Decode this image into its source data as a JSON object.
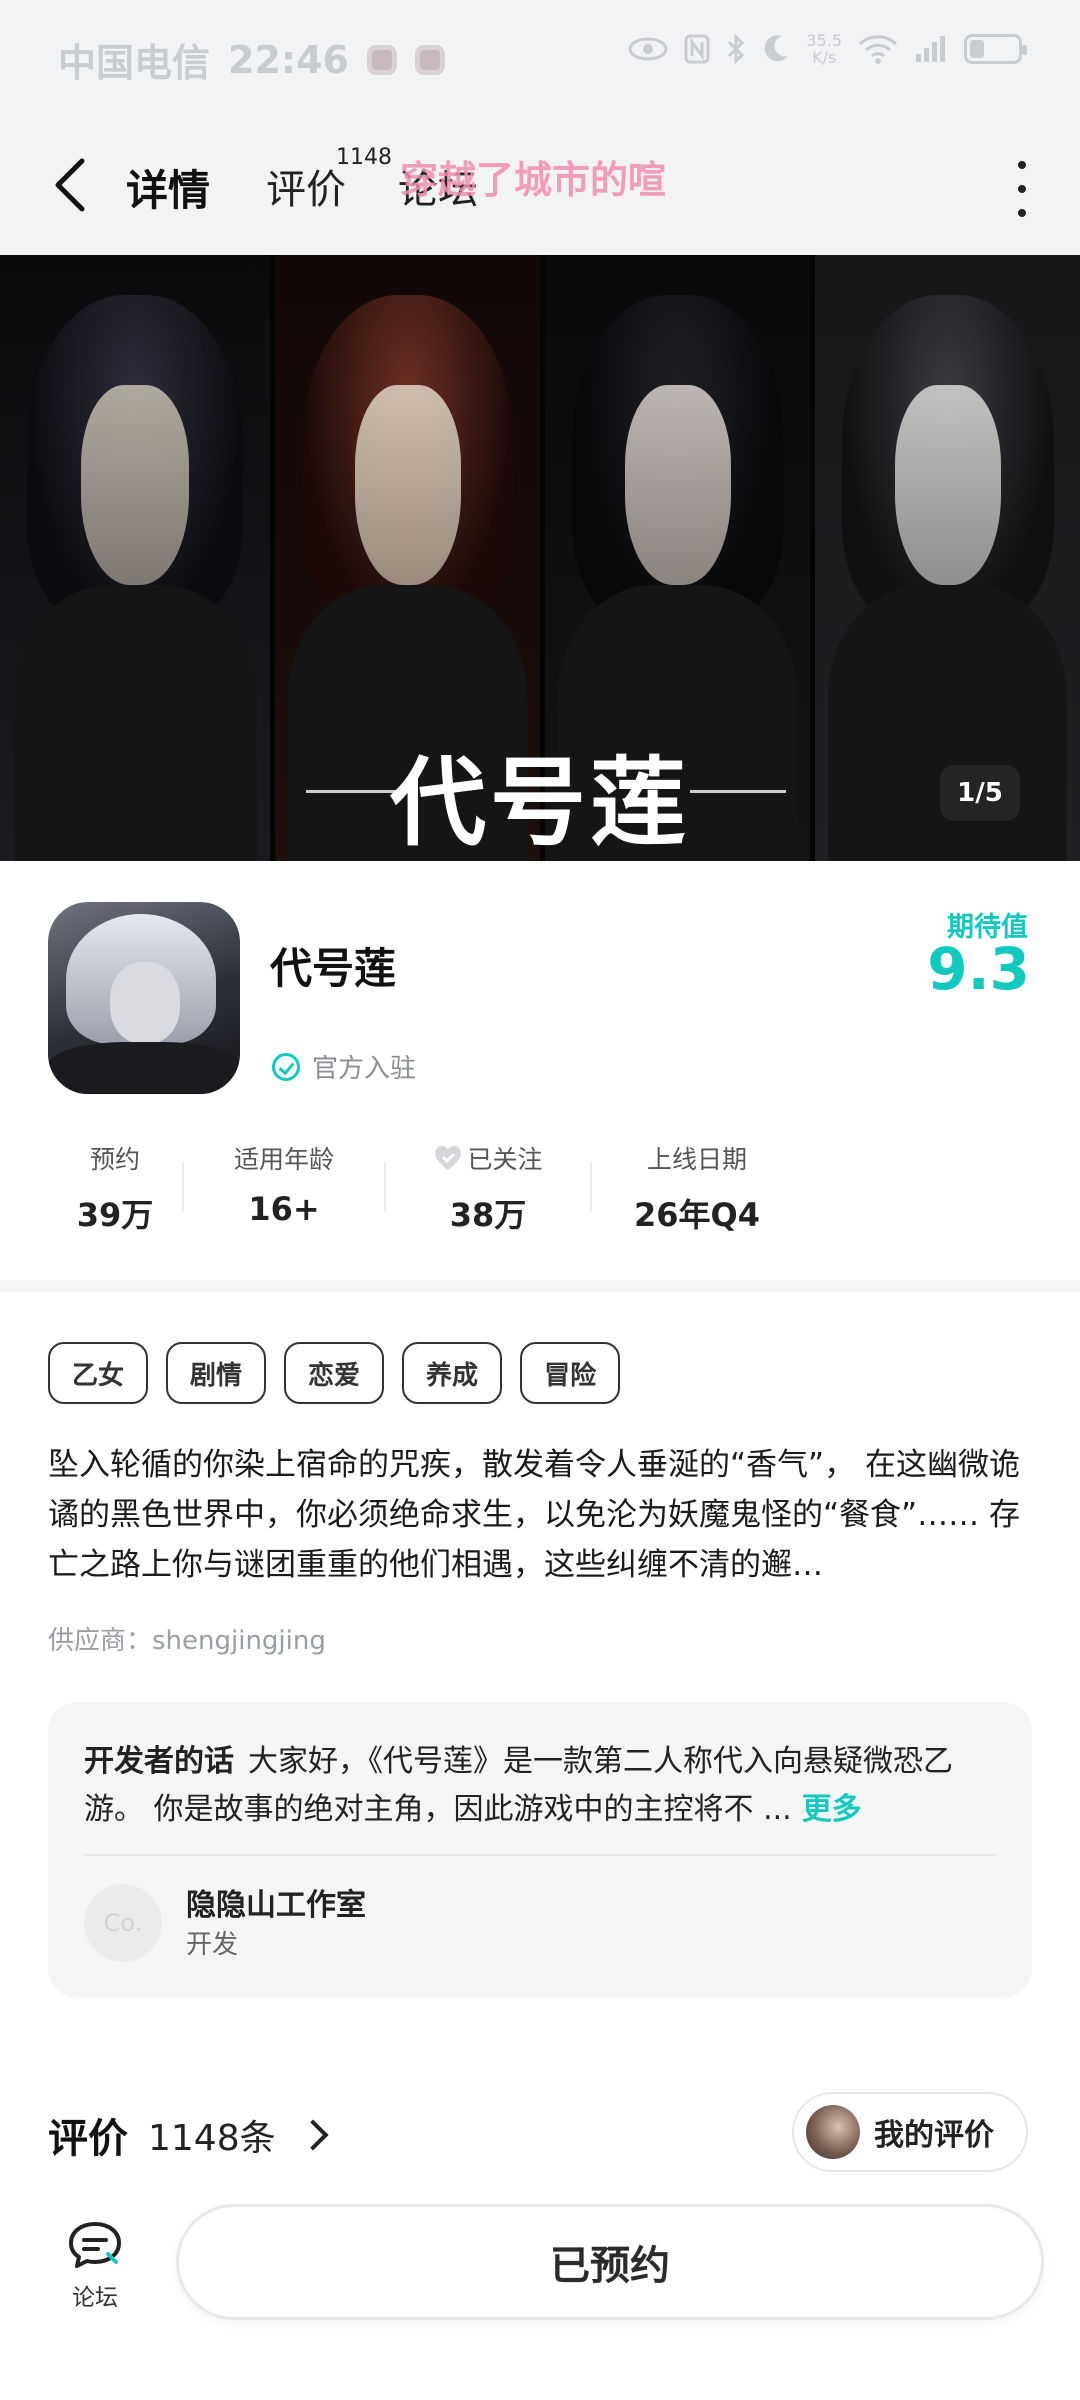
{
  "status_bar": {
    "carrier": "中国电信",
    "time": "22:46",
    "net_speed_top": "35.5",
    "net_speed_bottom": "K/s",
    "battery_level": 0.3
  },
  "nav": {
    "tabs": [
      {
        "label": "详情",
        "active": true
      },
      {
        "label": "评价",
        "badge": "1148"
      },
      {
        "label": "论坛"
      }
    ],
    "marquee_text": "穿越了城市的喧"
  },
  "banner": {
    "title": "代号莲",
    "page_indicator": "1/5"
  },
  "app": {
    "name": "代号莲",
    "official_label": "官方入驻",
    "expect_label": "期待值",
    "expect_value": "9.3"
  },
  "stats": [
    {
      "label": "预约",
      "value": "39万"
    },
    {
      "label": "适用年龄",
      "value": "16+"
    },
    {
      "label": "已关注",
      "value": "38万",
      "icon": "heart-icon"
    },
    {
      "label": "上线日期",
      "value": "26年Q4"
    }
  ],
  "tags": [
    "乙女",
    "剧情",
    "恋爱",
    "养成",
    "冒险"
  ],
  "description": "坠入轮循的你染上宿命的咒疾，散发着令人垂涎的“香气”， 在这幽微诡谲的黑色世界中，你必须绝命求生，以免沦为妖魔鬼怪的“餐食”…… 存亡之路上你与谜团重重的他们相遇，这些纠缠不清的邂…",
  "supplier": "供应商：shengjingjing",
  "developer": {
    "heading": "开发者的话",
    "words": "大家好，《代号莲》是一款第二人称代入向悬疑微恐乙游。 你是故事的绝对主角，因此游戏中的主控将不 ...",
    "more": "更多",
    "avatar_text": "Co.",
    "name": "隐隐山工作室",
    "role": "开发"
  },
  "reviews": {
    "title": "评价",
    "count": "1148条",
    "my_review_label": "我的评价"
  },
  "bottom": {
    "forum_label": "论坛",
    "reserved_label": "已预约"
  },
  "colors": {
    "accent": "#14c8c0",
    "marquee": "#f08fb0"
  }
}
